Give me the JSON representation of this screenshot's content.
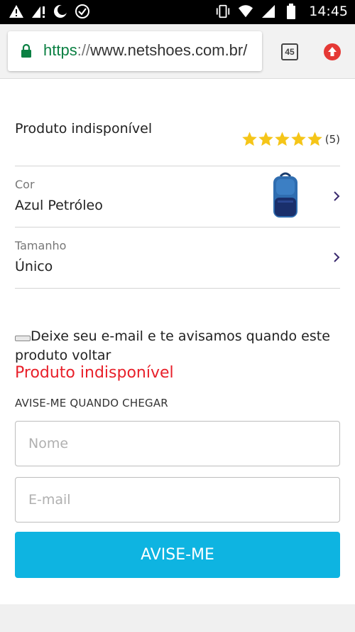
{
  "status_bar": {
    "time": "14:45",
    "left_icons": [
      "warning-icon",
      "signal-alert-icon",
      "moon-icon",
      "check-badge-icon"
    ],
    "right_icons": [
      "vibrate-icon",
      "wifi-icon",
      "cell-signal-icon",
      "battery-icon"
    ]
  },
  "browser": {
    "url_scheme": "https",
    "url_separator": "://",
    "url_host": "www.netshoes.com.br/",
    "tab_count": "45",
    "lock_color": "#0b8043",
    "upload_color": "#e53935"
  },
  "product": {
    "status": "Produto indisponível",
    "rating_stars": 5,
    "rating_count": "(5)",
    "star_color": "#f5c518"
  },
  "options": [
    {
      "label": "Cor",
      "value": "Azul Petróleo",
      "has_thumbnail": true
    },
    {
      "label": "Tamanho",
      "value": "Único",
      "has_thumbnail": false
    }
  ],
  "notify": {
    "message": "Deixe seu e-mail e te avisamos quando este produto voltar",
    "unavailable": "Produto indisponível",
    "section_label": "AVISE-ME QUANDO CHEGAR",
    "name_placeholder": "Nome",
    "email_placeholder": "E-mail",
    "button_label": "AVISE-ME",
    "button_color": "#0eb4e1"
  }
}
